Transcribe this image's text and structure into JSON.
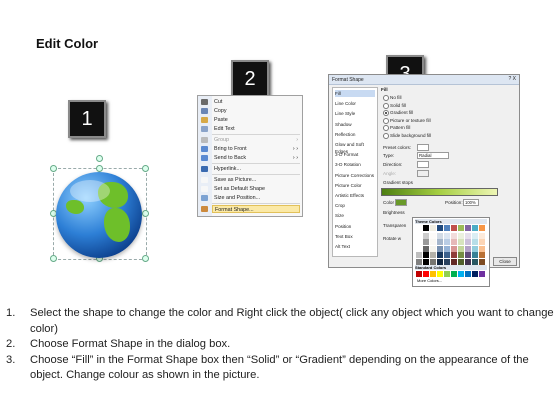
{
  "title": "Edit Color",
  "steps": [
    "1",
    "2",
    "3"
  ],
  "context_menu": {
    "items": [
      {
        "label": "Cut",
        "color": "#6a6a6a"
      },
      {
        "label": "Copy",
        "color": "#6a86b6"
      },
      {
        "label": "Paste",
        "color": "#d7a947"
      },
      {
        "label": "Edit Text",
        "color": "#8aa3c9"
      },
      {
        "label": "Group",
        "color": "#bbbbbb",
        "dim": true,
        "arrow": "›"
      },
      {
        "label": "Bring to Front",
        "color": "#5b8ad1",
        "arrow": "› ›"
      },
      {
        "label": "Send to Back",
        "color": "#5b8ad1",
        "arrow": "› ›"
      },
      {
        "label": "Hyperlink...",
        "color": "#3a6ab0"
      },
      {
        "label": "Save as Picture...",
        "color": "#f7f7f7"
      },
      {
        "label": "Set as Default Shape",
        "color": "#f7f7f7"
      },
      {
        "label": "Size and Position...",
        "color": "#7ca2d2"
      },
      {
        "label": "Format Shape...",
        "color": "#cc8a3e",
        "highlight": true
      }
    ]
  },
  "dialog": {
    "title": "Format Shape",
    "close_glyph": "?  X",
    "categories": [
      "Fill",
      "Line Color",
      "Line Style",
      "Shadow",
      "Reflection",
      "Glow and Soft Edges",
      "3-D Format",
      "3-D Rotation",
      "Picture Corrections",
      "Picture Color",
      "Artistic Effects",
      "Crop",
      "Size",
      "Position",
      "Text Box",
      "Alt Text"
    ],
    "section": "Fill",
    "fill_options": [
      "No fill",
      "Solid fill",
      "Gradient fill",
      "Picture or texture fill",
      "Pattern fill",
      "Slide background fill"
    ],
    "selected_fill": "Gradient fill",
    "labels": {
      "preset": "Preset colors:",
      "type": "Type:",
      "type_value": "Radial",
      "direction": "Direction:",
      "angle": "Angle:",
      "stops": "Gradient stops",
      "color": "Color",
      "position": "Position:",
      "position_value": "100%",
      "brightness": "Brightness",
      "transparency": "Transparen",
      "rotate": "Rotate w"
    },
    "close_button": "Close"
  },
  "palette": {
    "theme_label": "Theme Colors",
    "standard_label": "Standard Colors",
    "more": "More Colors...",
    "theme_top": [
      "#ffffff",
      "#000000",
      "#eeece1",
      "#1f497d",
      "#4f81bd",
      "#c0504d",
      "#9bbb59",
      "#8064a2",
      "#4bacc6",
      "#f79646"
    ],
    "standard": [
      "#c00000",
      "#ff0000",
      "#ffc000",
      "#ffff00",
      "#92d050",
      "#00b050",
      "#00b0f0",
      "#0070c0",
      "#002060",
      "#7030a0"
    ]
  },
  "instructions": [
    {
      "num": "1.",
      "text": "Select the shape to change the color and Right click the object( click any object which you want to change color)"
    },
    {
      "num": "2.",
      "text": "Choose Format Shape in the dialog box."
    },
    {
      "num": "3.",
      "text": "Choose “Fill” in the Format Shape box then “Solid” or “Gradient” depending on the appearance of the object. Change colour as shown in the picture."
    }
  ]
}
